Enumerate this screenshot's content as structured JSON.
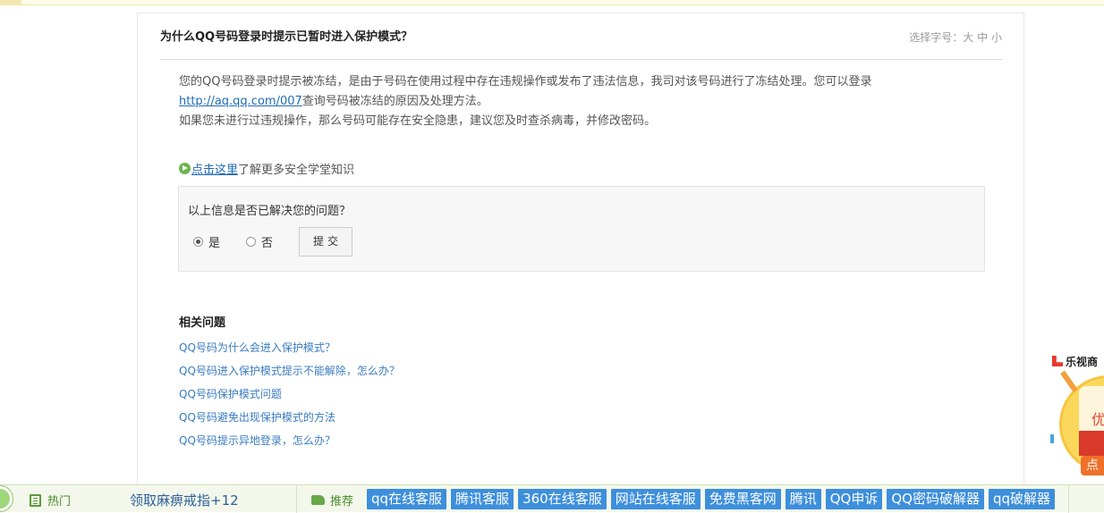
{
  "question": {
    "title": "为什么QQ号码登录时提示已暂时进入保护模式？",
    "font_size_label": "选择字号：",
    "font_sizes": [
      "大",
      "中",
      "小"
    ]
  },
  "answer": {
    "p1_before": "您的QQ号码登录时提示被冻结，是由于号码在使用过程中存在违规操作或发布了违法信息，我司对该号码进行了冻结处理。您可以登录",
    "p1_link": "http://aq.qq.com/007",
    "p1_after": "查询号码被冻结的原因及处理方法。",
    "p2": "如果您未进行过违规操作，那么号码可能存在安全隐患，建议您及时查杀病毒，并修改密码。",
    "more_link": "点击这里",
    "more_text": "了解更多安全学堂知识"
  },
  "feedback": {
    "question": "以上信息是否已解决您的问题？",
    "yes": "是",
    "no": "否",
    "selected": "是",
    "submit": "提交"
  },
  "related": {
    "title": "相关问题",
    "items": [
      "QQ号码为什么会进入保护模式？",
      "QQ号码进入保护模式提示不能解除，怎么办？",
      "QQ号码保护模式问题",
      "QQ号码避免出现保护模式的方法",
      "QQ号码提示异地登录，怎么办？"
    ]
  },
  "ad": {
    "brand": "乐视商",
    "text1": "优",
    "button": "点"
  },
  "bottom_bar": {
    "hot_label": "热门",
    "hot_link": "领取麻痹戒指+12",
    "rec_label": "推荐",
    "tags": [
      "qq在线客服",
      "腾讯客服",
      "360在线客服",
      "网站在线客服",
      "免费黑客网",
      "腾讯",
      "QQ申诉",
      "QQ密码破解器",
      "qq破解器"
    ]
  },
  "colors": {
    "link_blue": "#1e6bb8",
    "tag_blue": "#3d8fdc",
    "green_label": "#4a8a2c"
  }
}
